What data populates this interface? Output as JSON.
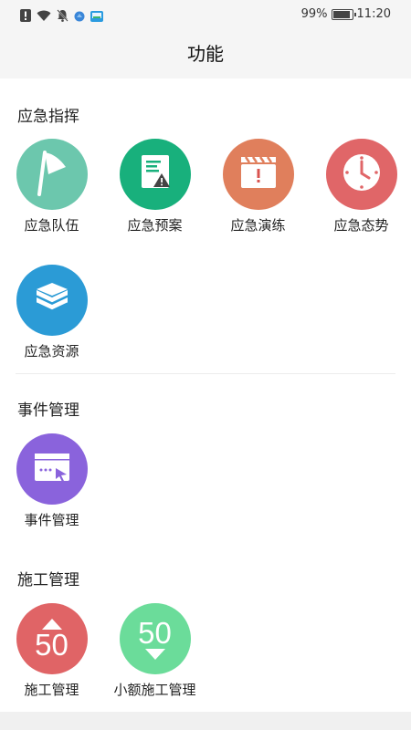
{
  "status_bar": {
    "battery": "99%",
    "battery_level": 0.99,
    "time": "11:20",
    "left_icons": [
      "alert-icon",
      "wifi-icon",
      "bell-off-icon",
      "browser-icon",
      "message-icon"
    ]
  },
  "header": {
    "title": "功能"
  },
  "sections": [
    {
      "title": "应急指挥",
      "items": [
        {
          "label": "应急队伍",
          "icon": "flag-icon",
          "color": "#6cc7ad"
        },
        {
          "label": "应急预案",
          "icon": "document-warning-icon",
          "color": "#18b07c"
        },
        {
          "label": "应急演练",
          "icon": "clapperboard-alert-icon",
          "color": "#e07f5c"
        },
        {
          "label": "应急态势",
          "icon": "clock-icon",
          "color": "#e06668"
        },
        {
          "label": "应急资源",
          "icon": "layers-icon",
          "color": "#2b9bd6"
        }
      ]
    },
    {
      "title": "事件管理",
      "items": [
        {
          "label": "事件管理",
          "icon": "window-cursor-icon",
          "color": "#8a63dc"
        }
      ]
    },
    {
      "title": "施工管理",
      "items": [
        {
          "label": "施工管理",
          "icon": "up-50-icon",
          "color": "#e06466",
          "badge": "50"
        },
        {
          "label": "小额施工管理",
          "icon": "down-50-icon",
          "color": "#6bdc9a",
          "badge": "50"
        }
      ]
    }
  ]
}
